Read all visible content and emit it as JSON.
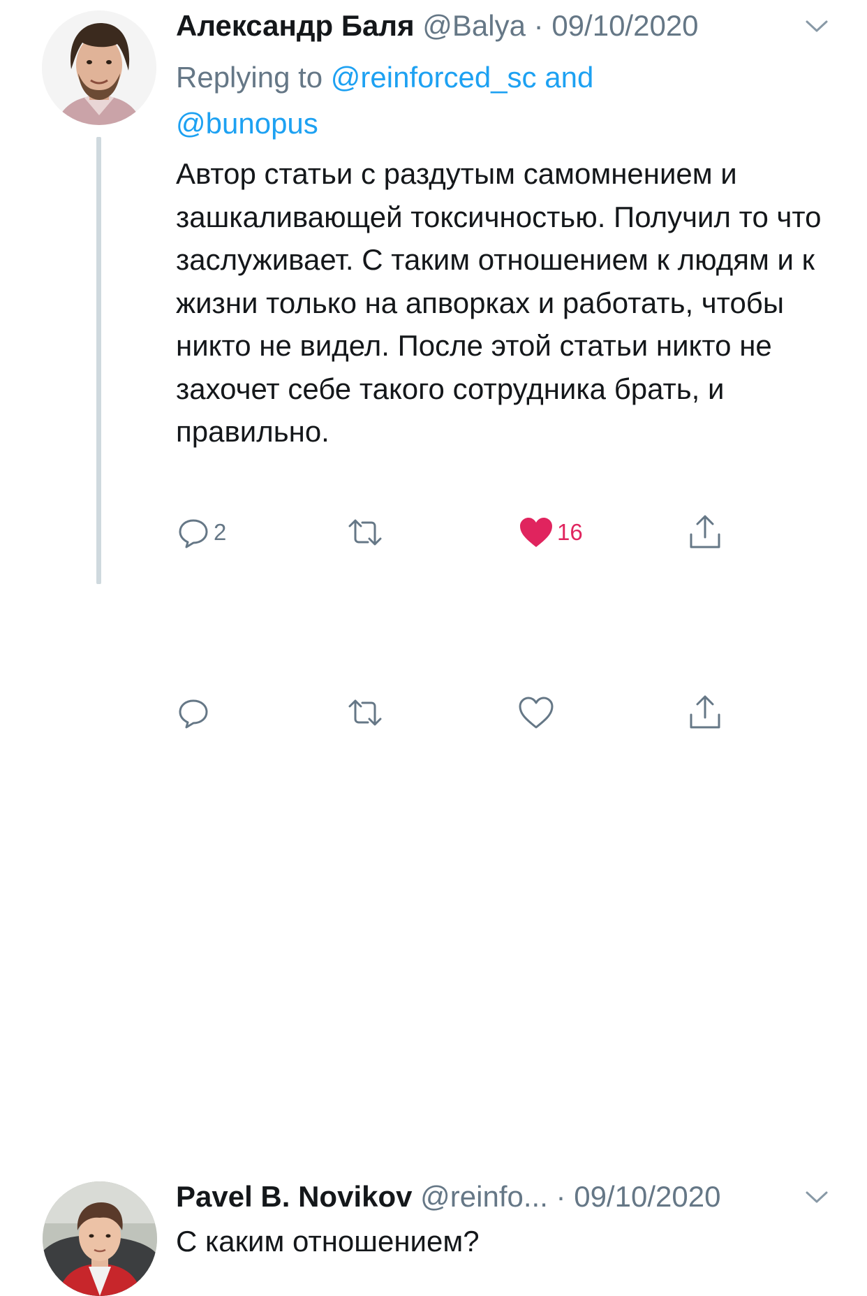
{
  "tweets": [
    {
      "author_name": "Александр Баля",
      "handle": "@Balya",
      "separator": "·",
      "date": "09/10/2020",
      "replying_prefix": "Replying to",
      "replying_mention_1": "@reinforced_sc",
      "replying_conjunction": "and",
      "replying_mention_2": "@bunopus",
      "text": "Автор статьи с раздутым самомнением и зашкаливающей токсичностью. Получил то что заслуживает. С таким отношением к людям и к жизни только на апворках и работать, чтобы никто не видел. После этой статьи никто не захочет себе такого сотрудника брать, и правильно.",
      "reply_count": "2",
      "retweet_count": "",
      "like_count": "16",
      "liked": true,
      "icons": [
        "reply-icon",
        "retweet-icon",
        "heart-icon",
        "share-icon",
        "chevron-down-icon"
      ]
    },
    {
      "author_name": "Pavel B. Novikov",
      "handle": "@reinfo...",
      "separator": "·",
      "date": "09/10/2020",
      "text": "С каким отношением?",
      "reply_count": "",
      "retweet_count": "",
      "like_count": "",
      "liked": false,
      "icons": [
        "reply-icon",
        "retweet-icon",
        "heart-icon",
        "share-icon",
        "chevron-down-icon"
      ]
    }
  ],
  "colors": {
    "text": "#14171a",
    "secondary": "#657786",
    "link": "#1da1f2",
    "like": "#e0245e",
    "thread_line": "#cfd9de"
  }
}
